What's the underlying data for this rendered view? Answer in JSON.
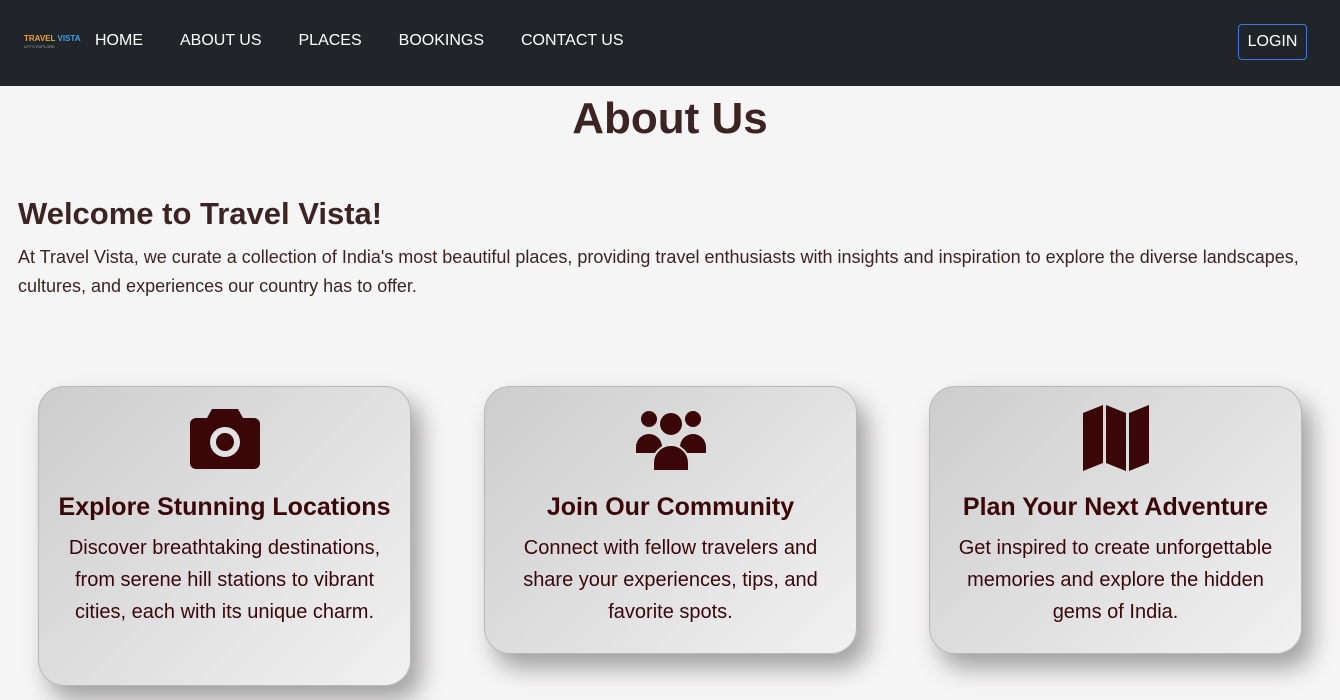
{
  "nav": {
    "logo": {
      "line1": "TRAVEL",
      "line1_accent": "VISTA",
      "line2": "LET'S EXPLORE"
    },
    "links": [
      "HOME",
      "ABOUT US",
      "PLACES",
      "BOOKINGS",
      "CONTACT US"
    ],
    "login": "LOGIN"
  },
  "page": {
    "title": "About Us",
    "welcome": "Welcome to Travel Vista!",
    "intro": "At Travel Vista, we curate a collection of India's most beautiful places, providing travel enthusiasts with insights and inspiration to explore the diverse landscapes, cultures, and experiences our country has to offer."
  },
  "cards": [
    {
      "icon": "camera-icon",
      "title": "Explore Stunning Locations",
      "text": "Discover breathtaking destinations, from serene hill stations to vibrant cities, each with its unique charm."
    },
    {
      "icon": "users-icon",
      "title": "Join Our Community",
      "text": "Connect with fellow travelers and share your experiences, tips, and favorite spots."
    },
    {
      "icon": "map-icon",
      "title": "Plan Your Next Adventure",
      "text": "Get inspired to create unforgettable memories and explore the hidden gems of India."
    }
  ],
  "colors": {
    "navbar": "#212529",
    "heading": "#3b2422",
    "card_text": "#3a0608",
    "icon": "#3a0608",
    "login_border": "#3d7bd9"
  }
}
